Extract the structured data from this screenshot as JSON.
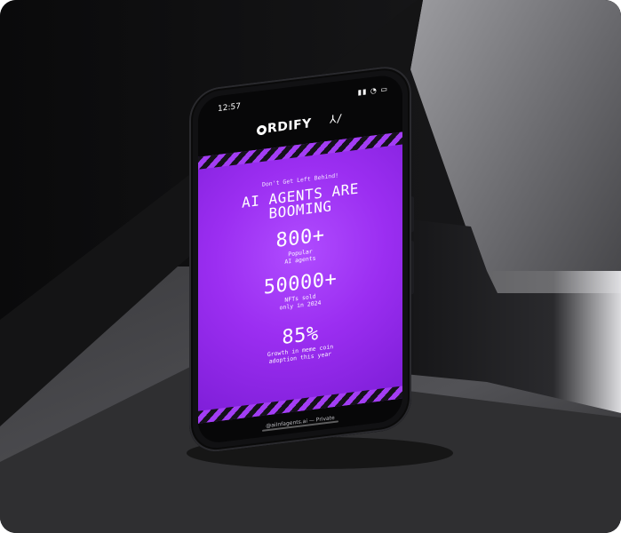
{
  "status": {
    "time": "12:57",
    "icons": "▮▮ ◔ ▭"
  },
  "app": {
    "brand": "RDIFY",
    "brand_mark": "⅄/"
  },
  "promo": {
    "kicker": "Don't Get Left Behind!",
    "headline_line1": "AI AGENTS ARE",
    "headline_line2": "BOOMING",
    "stats": [
      {
        "value": "800+",
        "caption_line1": "Popular",
        "caption_line2": "AI agents"
      },
      {
        "value": "50000+",
        "caption_line1": "NFTs sold",
        "caption_line2": "only in 2024"
      },
      {
        "value": "85%",
        "caption_line1": "Growth in meme coin",
        "caption_line2": "adoption this year"
      }
    ]
  },
  "footer": {
    "caption": "@aiInfagents.ai — Private"
  },
  "colors": {
    "background": "#0f0f10",
    "accent": "#9b2ef1",
    "stripe_dark": "#15121a"
  },
  "icons": [
    "logo-ring-icon",
    "status-signal-icon",
    "status-wifi-icon",
    "status-battery-icon"
  ]
}
